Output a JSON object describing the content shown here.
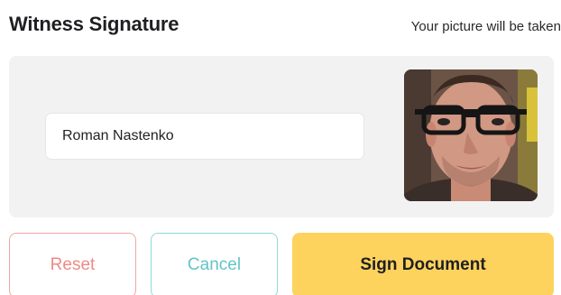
{
  "header": {
    "title": "Witness Signature",
    "subtitle": "Your picture will be taken"
  },
  "form": {
    "name_value": "Roman Nastenko"
  },
  "buttons": {
    "reset_label": "Reset",
    "cancel_label": "Cancel",
    "sign_label": "Sign Document"
  },
  "colors": {
    "panel_bg": "#f2f2f2",
    "reset": "#ef8a85",
    "cancel": "#62c5c7",
    "sign_bg": "#fdd35e"
  }
}
